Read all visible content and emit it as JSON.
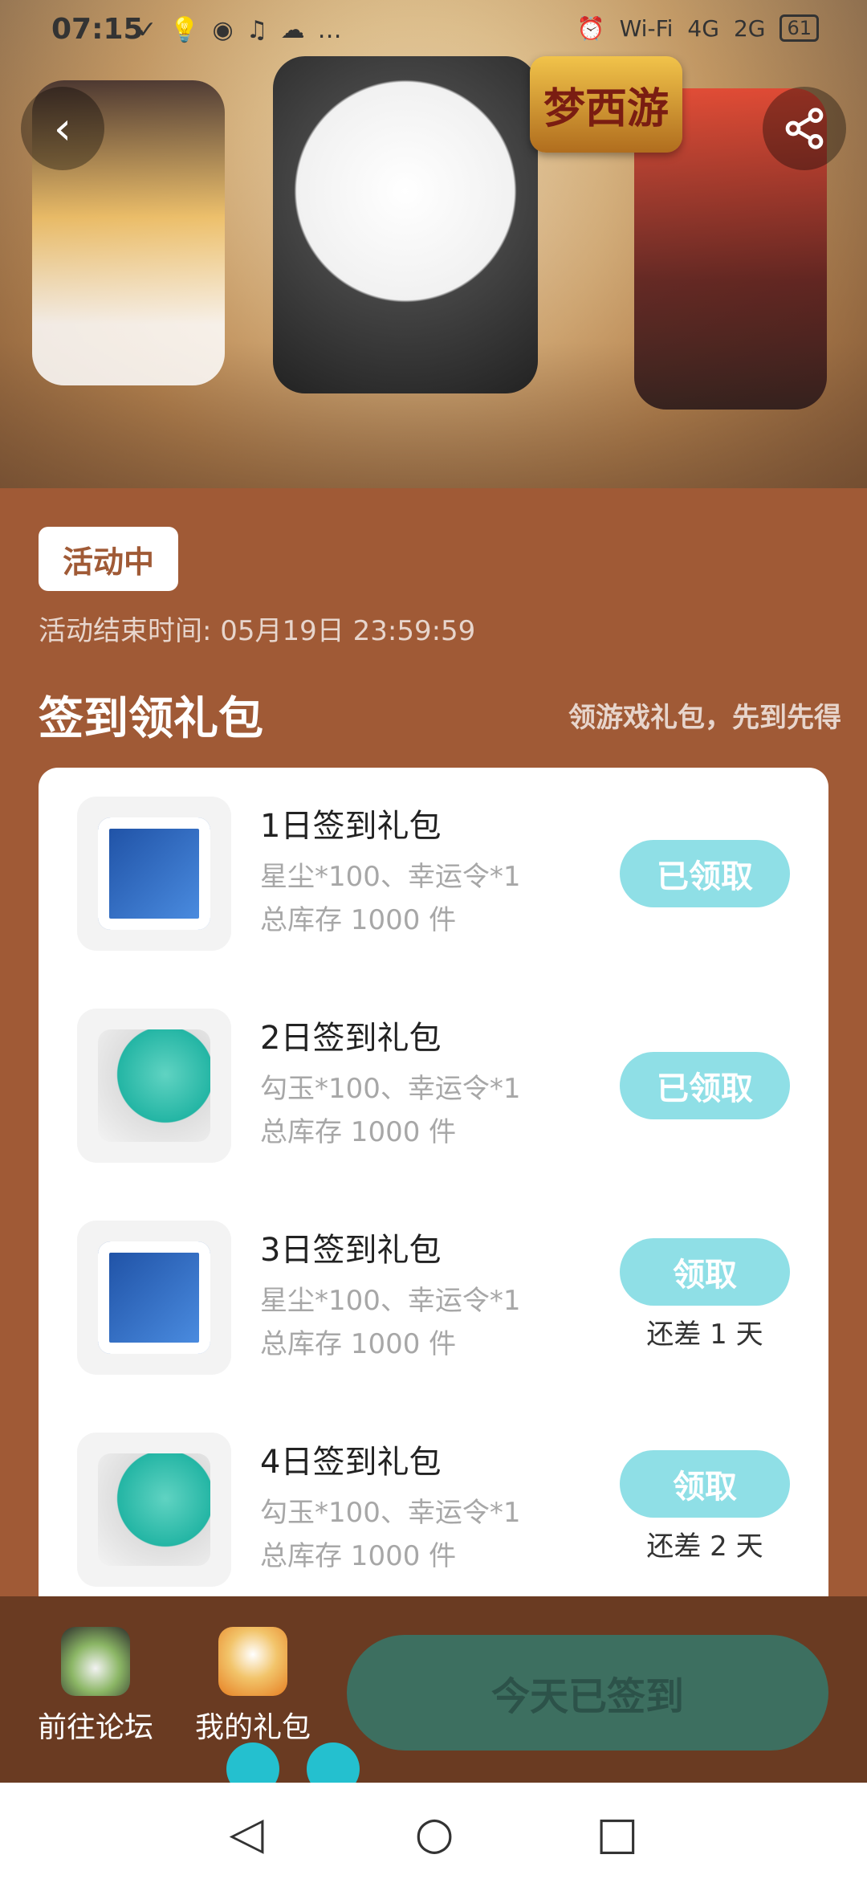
{
  "status_bar": {
    "time": "07:15",
    "notifications": [
      "✓",
      "💡",
      "◉",
      "♫",
      "☁",
      "…"
    ],
    "right_icons": [
      "⏰",
      "Wi‑Fi",
      "4G",
      "2G"
    ],
    "battery": "61"
  },
  "banner": {
    "back_icon": "chevron-left-icon",
    "share_icon": "share-icon",
    "logo_text": "梦西游"
  },
  "activity": {
    "status_tag": "活动中",
    "end_time": "活动结束时间: 05月19日 23:59:59"
  },
  "section": {
    "title": "签到领礼包",
    "subtitle": "领游戏礼包，先到先得"
  },
  "gifts": [
    {
      "title": "1日签到礼包",
      "desc": "星尘*100、幸运令*1",
      "stock": "总库存 1000 件",
      "button": "已领取",
      "remain": ""
    },
    {
      "title": "2日签到礼包",
      "desc": "勾玉*100、幸运令*1",
      "stock": "总库存 1000 件",
      "button": "已领取",
      "remain": ""
    },
    {
      "title": "3日签到礼包",
      "desc": "星尘*100、幸运令*1",
      "stock": "总库存 1000 件",
      "button": "领取",
      "remain": "还差 1 天"
    },
    {
      "title": "4日签到礼包",
      "desc": "勾玉*100、幸运令*1",
      "stock": "总库存 1000 件",
      "button": "领取",
      "remain": "还差 2 天"
    }
  ],
  "bottom_bar": {
    "forum_label": "前往论坛",
    "gifts_label": "我的礼包",
    "signed_label": "今天已签到"
  },
  "nav": {
    "back": "◁",
    "home": "○",
    "recent": "□"
  },
  "colors": {
    "background": "#a05a36",
    "button": "#8fdfe6",
    "signed_button": "#3d6f60"
  }
}
